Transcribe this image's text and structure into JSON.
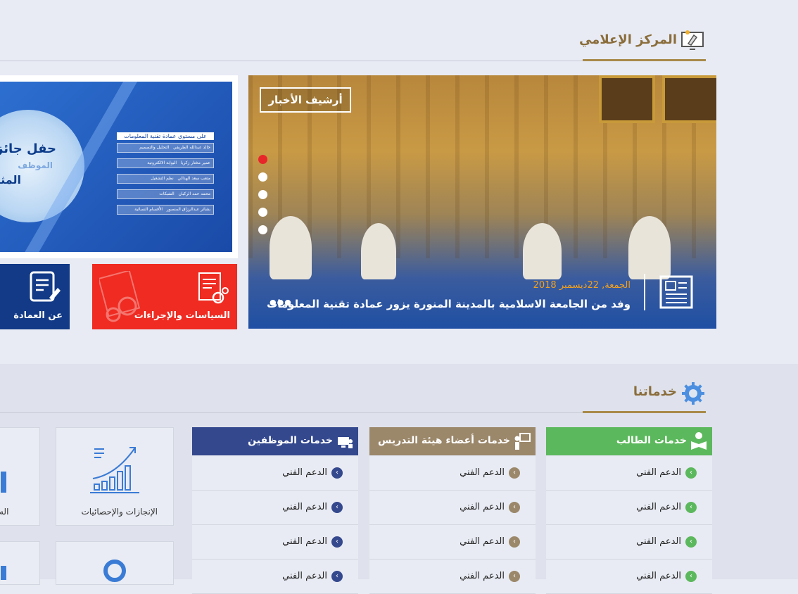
{
  "media_center": {
    "title": "المركز الإعلامي",
    "archive_label": "أرشيف الأخبار",
    "news_date": " الجمعة, 22ديسمبر 2018",
    "news_title": "وفد من الجامعة الاسلامية بالمدينة المنورة يزور عمادة تقنية المعلومات",
    "more": "●●●",
    "slide_count": 5,
    "active_slide": 1
  },
  "promo": {
    "title_line1": "حفل جائزة",
    "title_line2": "الموظف",
    "title_line3": "المثالي",
    "list_heading": "على مستوى عمادة تقنية المعلومات",
    "rows": [
      {
        "name": "خالد عبدالله الظريفي",
        "dept": "التحليل والتصميم"
      },
      {
        "name": "عمير مختار زكريا",
        "dept": "البوابة الالكترونية"
      },
      {
        "name": "متعب سعد الهذالي",
        "dept": "نظم التشغيل"
      },
      {
        "name": "محمد حمد الركبان",
        "dept": "الشبكات"
      },
      {
        "name": "بشائر عبدالرزاق المنصور",
        "dept": "الأقسام النسائية"
      }
    ]
  },
  "tiles": {
    "policies": "السياسات والإجراءات",
    "about": "عن العمادة"
  },
  "services": {
    "title": "خدماتنا",
    "columns": [
      {
        "title": "خدمات الطالب",
        "color": "#5cb85c",
        "items": [
          "الدعم الفني",
          "الدعم الفني",
          "الدعم الفني",
          "الدعم الفني"
        ]
      },
      {
        "title": "خدمات أعضاء هيئة التدريس",
        "color": "#9b876a",
        "items": [
          "الدعم الفني",
          "الدعم الفني",
          "الدعم الفني",
          "الدعم الفني"
        ]
      },
      {
        "title": "خدمات الموظفين",
        "color": "#34488e",
        "items": [
          "الدعم الفني",
          "الدعم الفني",
          "الدعم الفني",
          "الدعم الفني"
        ]
      }
    ],
    "stats_label": "الإنجازات والإحصائيات",
    "partial_label": "اله"
  },
  "colors": {
    "gold": "#a88a4a",
    "red": "#ef2b22",
    "navy": "#123a87"
  }
}
